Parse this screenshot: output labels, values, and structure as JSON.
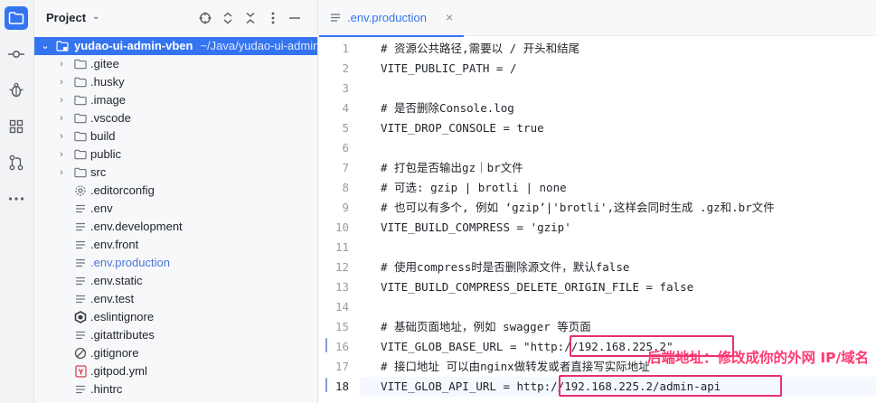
{
  "activity_bar": {
    "items": [
      {
        "name": "project-folder-icon",
        "active": true
      },
      {
        "name": "commit-icon",
        "active": false
      },
      {
        "name": "debug-bug-icon",
        "active": false
      },
      {
        "name": "structure-icon",
        "active": false
      },
      {
        "name": "pull-requests-icon",
        "active": false
      },
      {
        "name": "more-icon",
        "active": false
      }
    ]
  },
  "project_panel": {
    "title": "Project",
    "header_icons": [
      "locate-icon",
      "expand-all-icon",
      "collapse-all-icon",
      "more-icon",
      "minimize-icon"
    ],
    "root": {
      "name": "yudao-ui-admin-vben",
      "path": "~/Java/yudao-ui-admin"
    },
    "items": [
      {
        "label": ".gitee",
        "type": "folder"
      },
      {
        "label": ".husky",
        "type": "folder"
      },
      {
        "label": ".image",
        "type": "folder"
      },
      {
        "label": ".vscode",
        "type": "folder"
      },
      {
        "label": "build",
        "type": "folder"
      },
      {
        "label": "public",
        "type": "folder"
      },
      {
        "label": "src",
        "type": "folder"
      },
      {
        "label": ".editorconfig",
        "type": "gear"
      },
      {
        "label": ".env",
        "type": "text"
      },
      {
        "label": ".env.development",
        "type": "text"
      },
      {
        "label": ".env.front",
        "type": "text"
      },
      {
        "label": ".env.production",
        "type": "text",
        "modified": true
      },
      {
        "label": ".env.static",
        "type": "text"
      },
      {
        "label": ".env.test",
        "type": "text"
      },
      {
        "label": ".eslintignore",
        "type": "eslint"
      },
      {
        "label": ".gitattributes",
        "type": "text"
      },
      {
        "label": ".gitignore",
        "type": "ignore"
      },
      {
        "label": ".gitpod.yml",
        "type": "yaml"
      },
      {
        "label": ".hintrc",
        "type": "text"
      }
    ]
  },
  "editor": {
    "tab": {
      "label": ".env.production",
      "close": "×"
    },
    "current_line": 18,
    "lines": [
      {
        "n": "1",
        "text": "# 资源公共路径,需要以 / 开头和结尾"
      },
      {
        "n": "2",
        "text": "VITE_PUBLIC_PATH = /"
      },
      {
        "n": "3",
        "text": ""
      },
      {
        "n": "4",
        "text": "# 是否删除Console.log"
      },
      {
        "n": "5",
        "text": "VITE_DROP_CONSOLE = true"
      },
      {
        "n": "6",
        "text": ""
      },
      {
        "n": "7",
        "text": "# 打包是否输出gz｜br文件"
      },
      {
        "n": "8",
        "text": "# 可选: gzip | brotli | none"
      },
      {
        "n": "9",
        "text": "# 也可以有多个, 例如 ‘gzip’|'brotli',这样会同时生成 .gz和.br文件"
      },
      {
        "n": "10",
        "text": "VITE_BUILD_COMPRESS = 'gzip'"
      },
      {
        "n": "11",
        "text": ""
      },
      {
        "n": "12",
        "text": "# 使用compress时是否删除源文件，默认false"
      },
      {
        "n": "13",
        "text": "VITE_BUILD_COMPRESS_DELETE_ORIGIN_FILE = false"
      },
      {
        "n": "14",
        "text": ""
      },
      {
        "n": "15",
        "text": "# 基础页面地址，例如 swagger 等页面"
      },
      {
        "n": "16",
        "text": "VITE_GLOB_BASE_URL = \"http://192.168.225.2\""
      },
      {
        "n": "17",
        "text": "# 接口地址 可以由nginx做转发或者直接写实际地址"
      },
      {
        "n": "18",
        "text": "VITE_GLOB_API_URL = http://192.168.225.2/admin-api"
      }
    ],
    "annotation": "后端地址：修改成你的外网 IP/域名"
  },
  "colors": {
    "accent": "#3574f0",
    "highlight_box": "#e5306f",
    "annotation_text": "#ff3a72"
  }
}
